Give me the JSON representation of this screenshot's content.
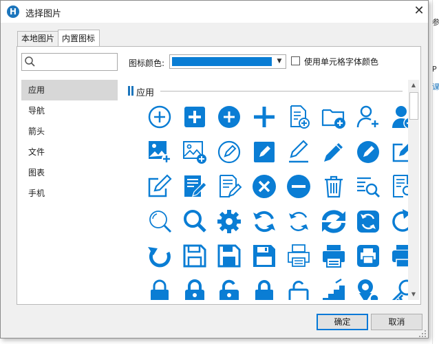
{
  "background": {
    "right_labels": [
      "参",
      "P",
      "课"
    ]
  },
  "dialog": {
    "title": "选择图片",
    "app_icon_letter": "H",
    "close_glyph": "✕"
  },
  "tabs": [
    {
      "label": "本地图片",
      "active": false
    },
    {
      "label": "内置图标",
      "active": true
    }
  ],
  "search": {
    "placeholder": "",
    "value": ""
  },
  "categories": [
    {
      "label": "应用",
      "selected": true
    },
    {
      "label": "导航",
      "selected": false
    },
    {
      "label": "箭头",
      "selected": false
    },
    {
      "label": "文件",
      "selected": false
    },
    {
      "label": "图表",
      "selected": false
    },
    {
      "label": "手机",
      "selected": false
    }
  ],
  "toolbar": {
    "color_label": "图标颜色:",
    "color_value": "#0a7dd4",
    "use_cell_font_color_label": "使用单元格字体颜色",
    "use_cell_font_color_checked": false
  },
  "section": {
    "title": "应用"
  },
  "icon_color": "#0a7dd4",
  "icons": [
    "plus-circle-outline-icon",
    "plus-square-icon",
    "plus-circle-filled-icon",
    "plus-icon",
    "file-add-icon",
    "folder-add-icon",
    "user-add-outline-icon",
    "user-add-filled-icon",
    "image-add-filled-icon",
    "image-add-outline-icon",
    "edit-circle-outline-icon",
    "edit-square-filled-icon",
    "pen-underline-icon",
    "pencil-icon",
    "edit-circle-filled-icon",
    "edit-square-outline-icon",
    "edit-box-icon",
    "document-edit-filled-icon",
    "document-edit-outline-icon",
    "close-circle-icon",
    "minus-circle-icon",
    "trash-icon",
    "list-search-icon",
    "document-search-icon",
    "search-outline-icon",
    "search-icon",
    "gear-icon",
    "refresh-icon",
    "refresh-outline-icon",
    "sync-icon",
    "sync-square-icon",
    "redo-icon",
    "undo-icon",
    "save-outline-icon",
    "save-icon",
    "save-filled-icon",
    "printer-outline-icon",
    "printer-filled-icon",
    "printer-square-icon",
    "printer-icon",
    "lock-outline-icon",
    "lock-filled-icon",
    "unlock-icon",
    "lock-icon",
    "unlock-outline-icon",
    "stairs-icon",
    "location-user-icon",
    "key-icon"
  ],
  "buttons": {
    "ok": "确定",
    "cancel": "取消"
  }
}
